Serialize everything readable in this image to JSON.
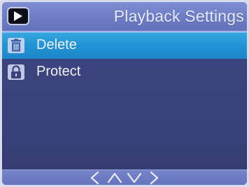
{
  "title_bar": {
    "mode_icon": "play-icon",
    "title": "Playback Settings"
  },
  "menu": {
    "items": [
      {
        "label": "Delete",
        "icon": "trash-icon",
        "selected": true
      },
      {
        "label": "Protect",
        "icon": "lock-icon",
        "selected": false
      }
    ]
  },
  "navigation": {
    "hints": [
      "left-arrow-icon",
      "up-arrow-icon",
      "down-arrow-icon",
      "right-arrow-icon"
    ]
  },
  "colors": {
    "background": "#3a437c",
    "title_bar": "#707fc6",
    "selected_item": "#2293d4",
    "text": "#eef0fa"
  }
}
